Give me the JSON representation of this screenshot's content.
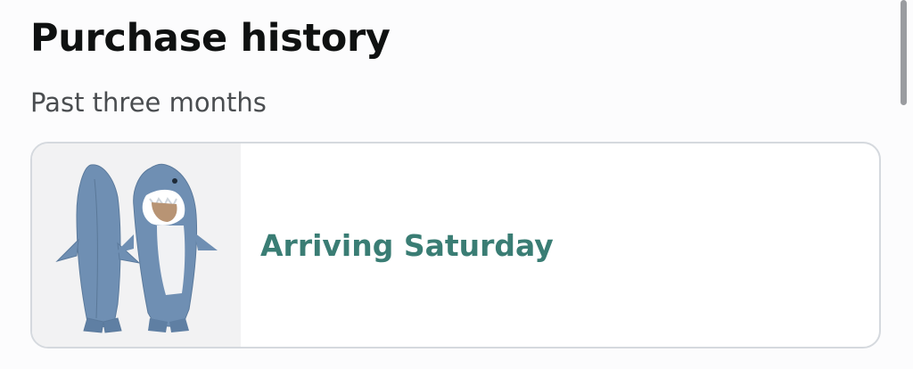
{
  "header": {
    "title": "Purchase history",
    "subtitle": "Past three months"
  },
  "orders": [
    {
      "status": "Arriving Saturday",
      "thumbnail_icon": "shark-blanket-product-image"
    }
  ],
  "colors": {
    "status_accent": "#3a7d74",
    "title_text": "#0f1111",
    "subtitle_text": "#4a4d50",
    "card_border": "#d5d9de"
  }
}
